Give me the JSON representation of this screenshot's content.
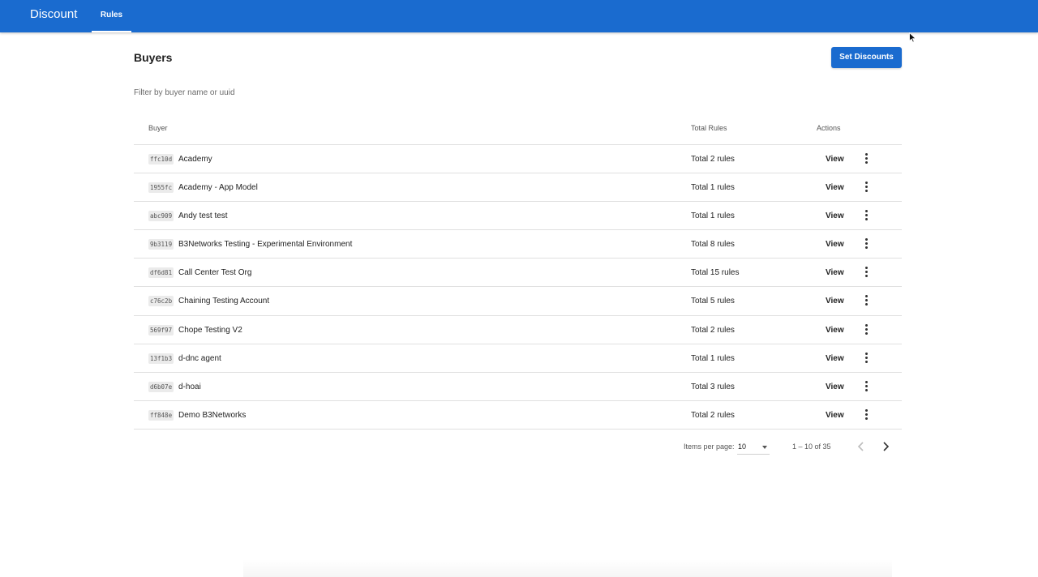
{
  "app": {
    "title": "Discount"
  },
  "nav": {
    "tabs": [
      {
        "label": "Rules",
        "active": true
      }
    ]
  },
  "page": {
    "title": "Buyers",
    "action_label": "Set Discounts"
  },
  "filter": {
    "placeholder": "Filter by buyer name or uuid"
  },
  "table": {
    "headers": {
      "buyer": "Buyer",
      "total": "Total Rules",
      "actions": "Actions"
    },
    "rows": [
      {
        "uuid": "ffc10d",
        "name": "Academy",
        "total": "Total 2 rules",
        "action": "View"
      },
      {
        "uuid": "1955fc",
        "name": "Academy - App Model",
        "total": "Total 1 rules",
        "action": "View"
      },
      {
        "uuid": "abc909",
        "name": "Andy test test",
        "total": "Total 1 rules",
        "action": "View"
      },
      {
        "uuid": "9b3119",
        "name": "B3Networks Testing - Experimental Environment",
        "total": "Total 8 rules",
        "action": "View"
      },
      {
        "uuid": "df6d81",
        "name": "Call Center Test Org",
        "total": "Total 15 rules",
        "action": "View"
      },
      {
        "uuid": "c76c2b",
        "name": "Chaining Testing Account",
        "total": "Total 5 rules",
        "action": "View"
      },
      {
        "uuid": "569f97",
        "name": "Chope Testing V2",
        "total": "Total 2 rules",
        "action": "View"
      },
      {
        "uuid": "13f1b3",
        "name": "d-dnc agent",
        "total": "Total 1 rules",
        "action": "View"
      },
      {
        "uuid": "d6b07e",
        "name": "d-hoai",
        "total": "Total 3 rules",
        "action": "View"
      },
      {
        "uuid": "ff848e",
        "name": "Demo B3Networks",
        "total": "Total 2 rules",
        "action": "View"
      }
    ]
  },
  "paginator": {
    "items_per_page_label": "Items per page:",
    "items_per_page": "10",
    "range": "1 – 10 of 35"
  },
  "colors": {
    "primary": "#1a6bcf",
    "header_text": "#ffffff",
    "divider": "#e0e0e0"
  },
  "icons": {
    "row_menu": "more-vert-icon",
    "prev": "chevron-left-icon",
    "next": "chevron-right-icon",
    "select": "caret-down-icon",
    "pointer": "mouse-pointer-icon"
  }
}
